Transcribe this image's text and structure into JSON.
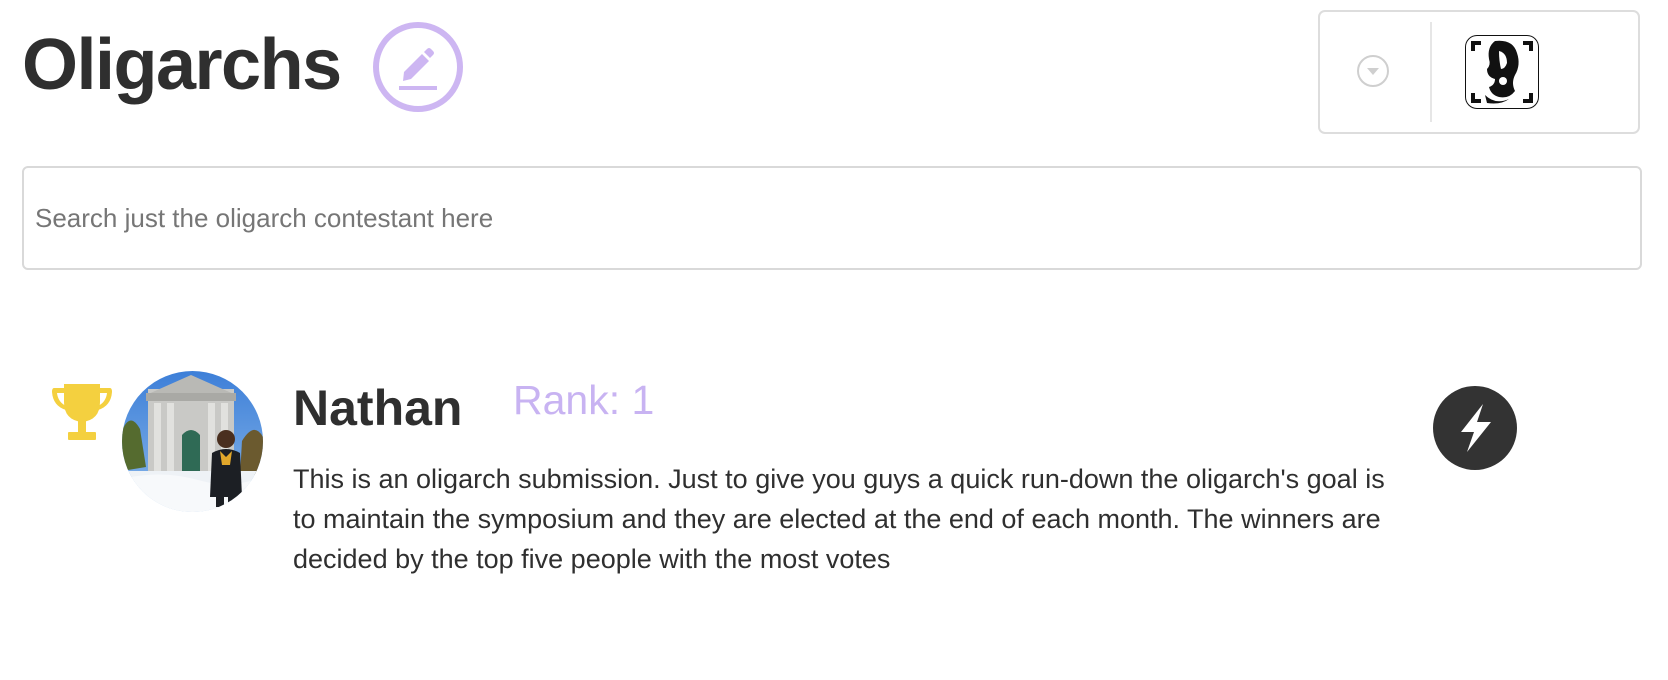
{
  "header": {
    "title": "Oligarchs",
    "edit_icon": "pencil-icon",
    "accent_color": "#cdb6f2"
  },
  "user_menu": {
    "dropdown_icon": "chevron-down-circle-icon",
    "avatar_icon": "profile-avatar-icon"
  },
  "search": {
    "placeholder": "Search just the oligarch contestant here",
    "value": ""
  },
  "contestants": [
    {
      "name": "Nathan",
      "rank_label": "Rank: 1",
      "description": "This is an oligarch submission. Just to give you guys a quick run-down the oligarch's goal is to maintain the symposium and they are elected at the end of each month. The winners are decided by the top five people with the most votes",
      "badge_icon": "trophy-icon",
      "badge_color": "#f4d03f",
      "action_icon": "lightning-bolt-icon"
    }
  ]
}
